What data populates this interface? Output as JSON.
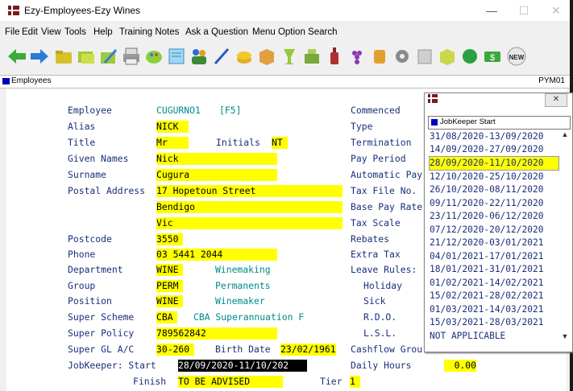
{
  "window": {
    "title": "Ezy-Employees-Ezy Wines",
    "minimize": "—",
    "maximize": "☐",
    "close": "✕"
  },
  "menu": [
    "File",
    "Edit",
    "View",
    "Tools",
    "Help",
    "Training Notes",
    "Ask a Question",
    "Menu Option Search"
  ],
  "toolbar": {
    "icons": [
      "back-arrow-icon",
      "forward-arrow-icon",
      "open-folder-icon",
      "sliding-folders-icon",
      "edit-folder-icon",
      "printer-icon",
      "paint-icon",
      "notes-icon",
      "people-icon",
      "wand-icon",
      "coins-icon",
      "box-icon",
      "glass-icon",
      "cashregister-icon",
      "bottle-icon",
      "grapes-icon",
      "jar-icon",
      "gear-icon",
      "blank-icon",
      "cube-icon",
      "grape-leaf-icon",
      "dollar-icon",
      "new-icon"
    ],
    "new_label": "NEW"
  },
  "strip": {
    "label": "Employees",
    "code": "PYM01"
  },
  "form": {
    "employee_label": "Employee",
    "employee_code": "CUGURNO1",
    "employee_key": "[F5]",
    "alias_label": "Alias",
    "alias": "NICK",
    "title_label": "Title",
    "title": "Mr",
    "initials_label": "Initials",
    "initials": "NT",
    "given_label": "Given Names",
    "given": "Nick",
    "surname_label": "Surname",
    "surname": "Cugura",
    "postal_label": "Postal Address",
    "addr1": "17 Hopetoun Street",
    "addr2": "Bendigo",
    "addr3": "Vic",
    "postcode_label": "Postcode",
    "postcode": "3550",
    "phone_label": "Phone",
    "phone": "03 5441 2044",
    "dept_label": "Department",
    "dept_code": "WINE",
    "dept_name": "Winemaking",
    "group_label": "Group",
    "group_code": "PERM",
    "group_name": "Permanents",
    "position_label": "Position",
    "position_code": "WINE",
    "position_name": "Winemaker",
    "super_label": "Super Scheme",
    "super_code": "CBA",
    "super_name": "CBA Superannuation F",
    "policy_label": "Super Policy",
    "policy": "789562842",
    "gl_label": "Super GL A/C",
    "gl": "30-260",
    "birth_label": "Birth Date",
    "birth": "23/02/1961",
    "jk_label": "JobKeeper: Start",
    "jk_start": "28/09/2020-11/10/202",
    "finish_label": "Finish",
    "finish": "TO BE ADVISED",
    "tier_label": "Tier",
    "tier": "1",
    "right": {
      "commenced": "Commenced",
      "type": "Type",
      "termination": "Termination",
      "pay_period": "Pay Period",
      "auto_pay": "Automatic Pay",
      "tfn": "Tax File No.",
      "base_pay": "Base Pay Rate",
      "tax_scale": "Tax Scale",
      "rebates": "Rebates",
      "extra_tax": "Extra Tax",
      "leave_rules": "Leave Rules:",
      "holiday": "Holiday",
      "sick": "Sick",
      "rdo": "R.D.O.",
      "lsl": "L.S.L.",
      "cashflow": "Cashflow Grou",
      "daily_hours": "Daily Hours",
      "daily_hours_value": "0.00"
    }
  },
  "popup": {
    "close": "✕",
    "header": "JobKeeper Start",
    "items": [
      "31/08/2020-13/09/2020",
      "14/09/2020-27/09/2020",
      "28/09/2020-11/10/2020",
      "12/10/2020-25/10/2020",
      "26/10/2020-08/11/2020",
      "09/11/2020-22/11/2020",
      "23/11/2020-06/12/2020",
      "07/12/2020-20/12/2020",
      "21/12/2020-03/01/2021",
      "04/01/2021-17/01/2021",
      "18/01/2021-31/01/2021",
      "01/02/2021-14/02/2021",
      "15/02/2021-28/02/2021",
      "01/03/2021-14/03/2021",
      "15/03/2021-28/03/2021",
      "NOT APPLICABLE"
    ],
    "selected_index": 2,
    "scroll_up": "▲",
    "scroll_down": "▼"
  }
}
